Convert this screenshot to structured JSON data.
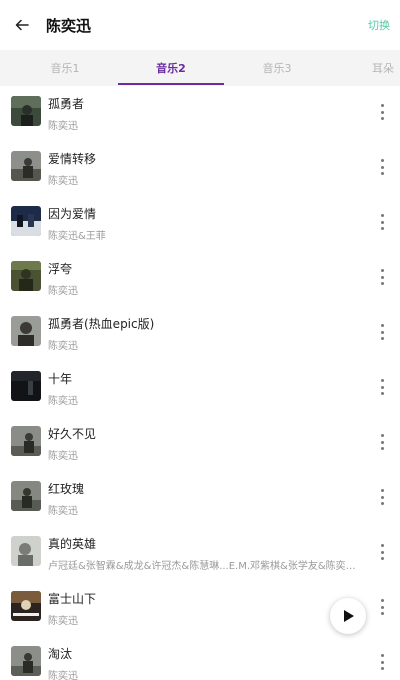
{
  "header": {
    "title": "陈奕迅",
    "switch_label": "切换"
  },
  "tabs": [
    {
      "label": "音乐1"
    },
    {
      "label": "音乐2"
    },
    {
      "label": "音乐3"
    },
    {
      "label": "耳朵"
    }
  ],
  "active_tab": "音乐2",
  "colors": {
    "accent": "#6a2ca0",
    "switch": "#58c7a7",
    "artist_text": "#9a9a9a"
  },
  "songs": [
    {
      "title": "孤勇者",
      "artist": "陈奕迅",
      "cover": "dark-green-cover"
    },
    {
      "title": "爱情转移",
      "artist": "陈奕迅",
      "cover": "grey-cover"
    },
    {
      "title": "因为爱情",
      "artist": "陈奕迅&王菲",
      "cover": "blue-cover"
    },
    {
      "title": "浮夸",
      "artist": "陈奕迅",
      "cover": "olive-cover"
    },
    {
      "title": "孤勇者(热血epic版)",
      "artist": "陈奕迅",
      "cover": "portrait-cover"
    },
    {
      "title": "十年",
      "artist": "陈奕迅",
      "cover": "black-cover"
    },
    {
      "title": "好久不见",
      "artist": "陈奕迅",
      "cover": "grey-cover"
    },
    {
      "title": "红玫瑰",
      "artist": "陈奕迅",
      "cover": "grey-cover"
    },
    {
      "title": "真的英雄",
      "artist": "卢冠廷&张智霖&成龙&许冠杰&陈慧琳...E.M.邓紫棋&张学友&陈奕迅&谭咏麟",
      "cover": "light-grey-cover"
    },
    {
      "title": "富士山下",
      "artist": "陈奕迅",
      "cover": "stage-cover"
    },
    {
      "title": "淘汰",
      "artist": "陈奕迅",
      "cover": "grey-cover"
    }
  ],
  "icons": {
    "back": "arrow-left-icon",
    "more": "more-vertical-icon",
    "play": "play-icon"
  }
}
